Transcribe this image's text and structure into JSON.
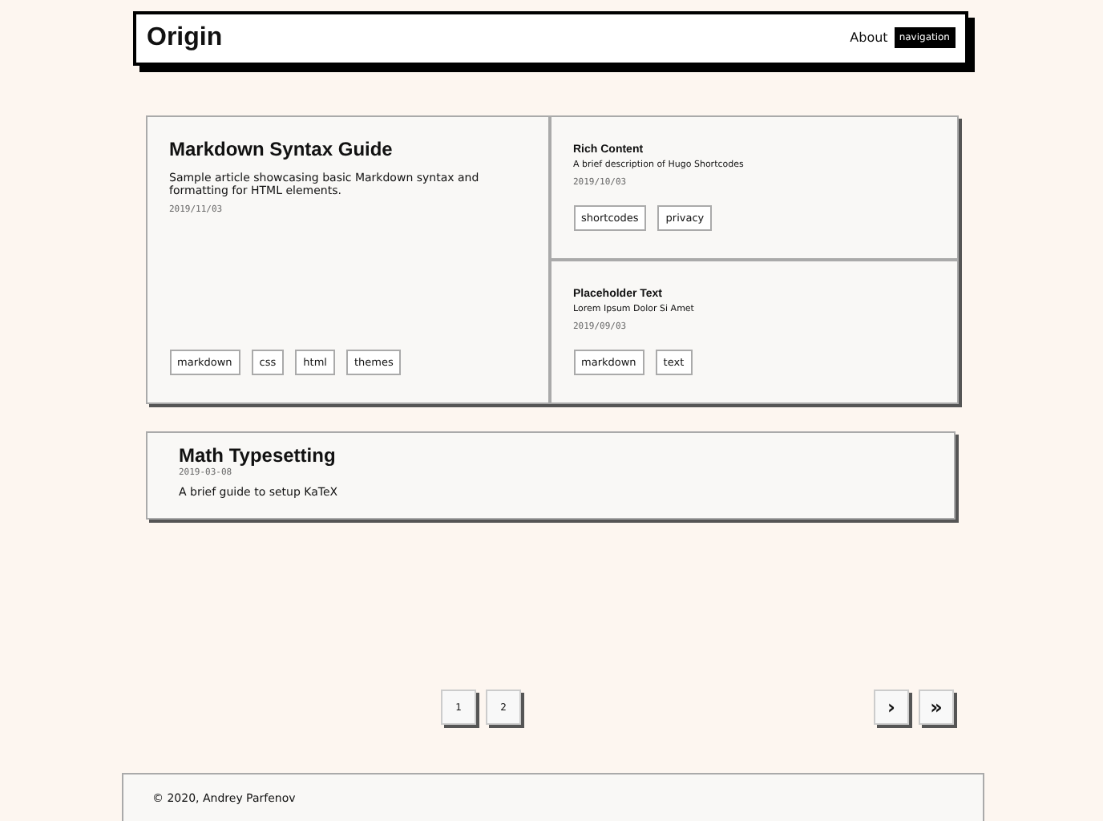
{
  "header": {
    "logo": "Origin",
    "nav": [
      {
        "label": "About",
        "kind": "link"
      },
      {
        "label": "navigation",
        "kind": "box"
      }
    ]
  },
  "featured": {
    "title": "Markdown Syntax Guide",
    "summary": "Sample article showcasing basic Markdown syntax and formatting for HTML elements.",
    "date": "2019/11/03",
    "tags": [
      "markdown",
      "css",
      "html",
      "themes"
    ]
  },
  "side_posts": [
    {
      "title": "Rich Content",
      "summary": "A brief description of Hugo Shortcodes",
      "date": "2019/10/03",
      "tags": [
        "shortcodes",
        "privacy"
      ]
    },
    {
      "title": "Placeholder Text",
      "summary": "Lorem Ipsum Dolor Si Amet",
      "date": "2019/09/03",
      "tags": [
        "markdown",
        "text"
      ]
    }
  ],
  "list_posts": [
    {
      "title": "Math Typesetting",
      "date": "2019-03-08",
      "summary": "A brief guide to setup KaTeX"
    }
  ],
  "pagination": {
    "pages": [
      "1",
      "2"
    ],
    "next": "›",
    "last": "»"
  },
  "footer": {
    "text": "© 2020, Andrey Parfenov"
  }
}
